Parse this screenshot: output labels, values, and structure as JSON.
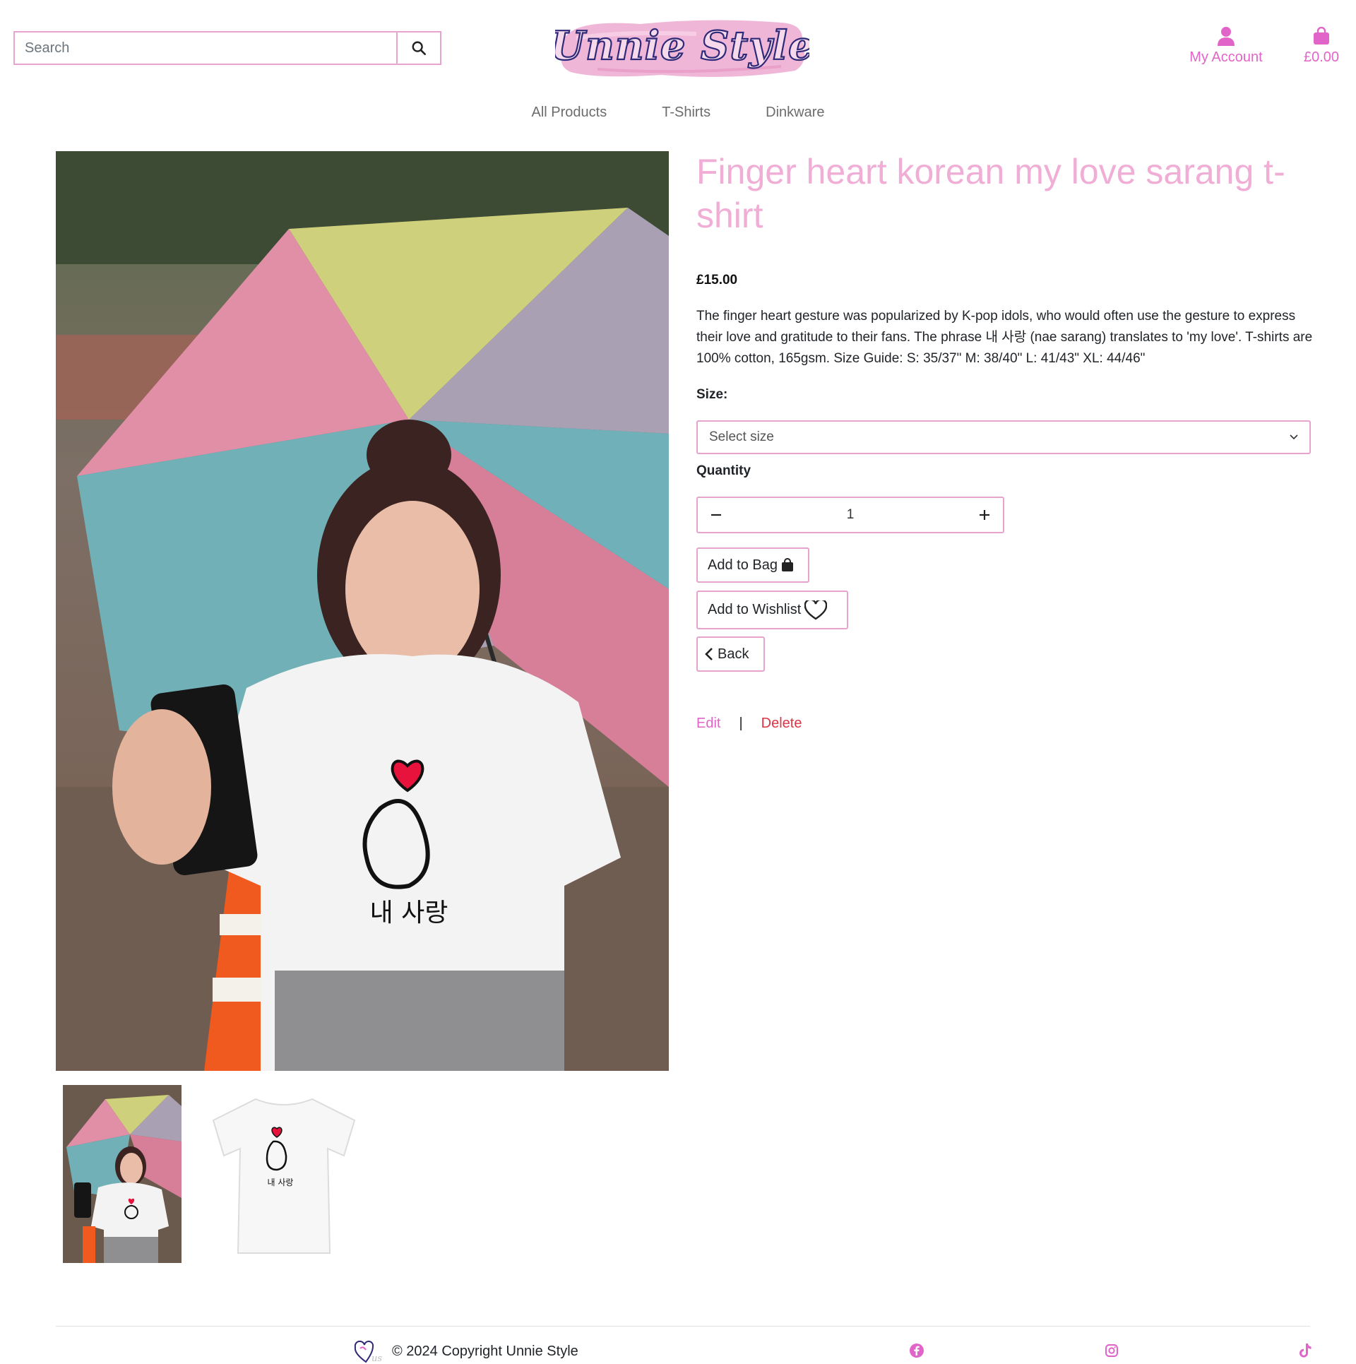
{
  "header": {
    "search_placeholder": "Search",
    "logo_text": "Unnie Style",
    "account_label": "My Account",
    "bag_total": "£0.00"
  },
  "nav": {
    "items": [
      "All Products",
      "T-Shirts",
      "Dinkware"
    ]
  },
  "product": {
    "title": "Finger heart korean my love sarang t-shirt",
    "price": "£15.00",
    "description": "The finger heart gesture was popularized by K-pop idols, who would often use the gesture to express their love and gratitude to their fans. The phrase 내 사랑 (nae sarang) translates to 'my love'. T-shirts are 100% cotton, 165gsm. Size Guide: S: 35/37\" M: 38/40\" L: 41/43\" XL: 44/46\"",
    "size_label": "Size:",
    "size_selected": "Select size",
    "quantity_label": "Quantity",
    "quantity": "1",
    "shirt_print_text": "내 사랑"
  },
  "actions": {
    "add_to_bag": "Add to Bag",
    "add_to_wishlist": "Add to Wishlist",
    "back": "Back",
    "edit": "Edit",
    "separator": "|",
    "delete": "Delete"
  },
  "footer": {
    "copyright": "© 2024 Copyright Unnie Style"
  },
  "icons": {
    "search": "search-icon",
    "account": "user-icon",
    "bag": "shopping-bag-icon",
    "minus": "minus-icon",
    "plus": "plus-icon",
    "heart": "heart-outline-icon",
    "back": "chevron-left-icon",
    "facebook": "facebook-icon",
    "instagram": "instagram-icon",
    "tiktok": "tiktok-icon"
  },
  "colors": {
    "brand_pink": "#e164c8",
    "title_pink": "#f0aed6",
    "border_pink": "#e9a3cf",
    "delete_red": "#dc3545"
  }
}
